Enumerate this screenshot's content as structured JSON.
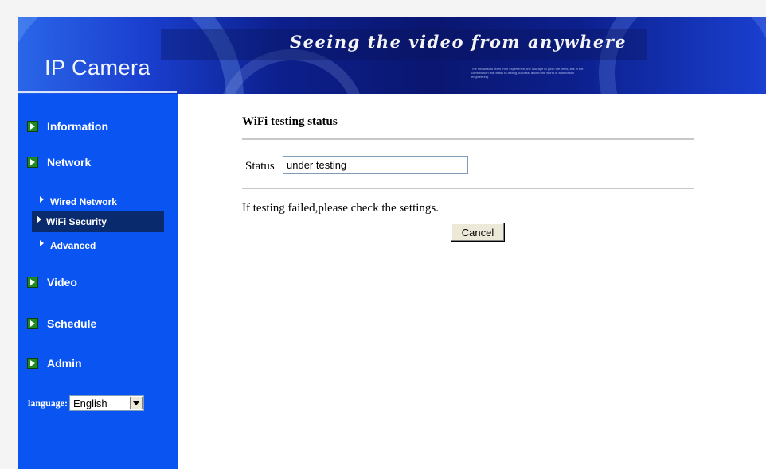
{
  "header": {
    "logo_text": "IP Camera",
    "slogan": "Seeing the video from anywhere",
    "fine_print": "The smallest to learn from experience, the courage to push the limits, lies in the combination that leads to lasting success, also in the world of automation engineering."
  },
  "sidebar": {
    "items": [
      {
        "label": "Information"
      },
      {
        "label": "Network"
      },
      {
        "label": "Video"
      },
      {
        "label": "Schedule"
      },
      {
        "label": "Admin"
      }
    ],
    "network_sub": [
      {
        "label": "Wired Network"
      },
      {
        "label": "WiFi Security",
        "active": true
      },
      {
        "label": "Advanced"
      }
    ],
    "language": {
      "label": "language:",
      "value": "English"
    }
  },
  "main": {
    "title": "WiFi testing status",
    "status_label": "Status",
    "status_value": "under testing",
    "help_text": "If testing failed,please check the settings.",
    "cancel_label": "Cancel"
  },
  "colors": {
    "sidebar_bg": "#0a54f2",
    "active_sub_bg": "#0a2a6e",
    "nav_icon": "#1f8a1f"
  }
}
